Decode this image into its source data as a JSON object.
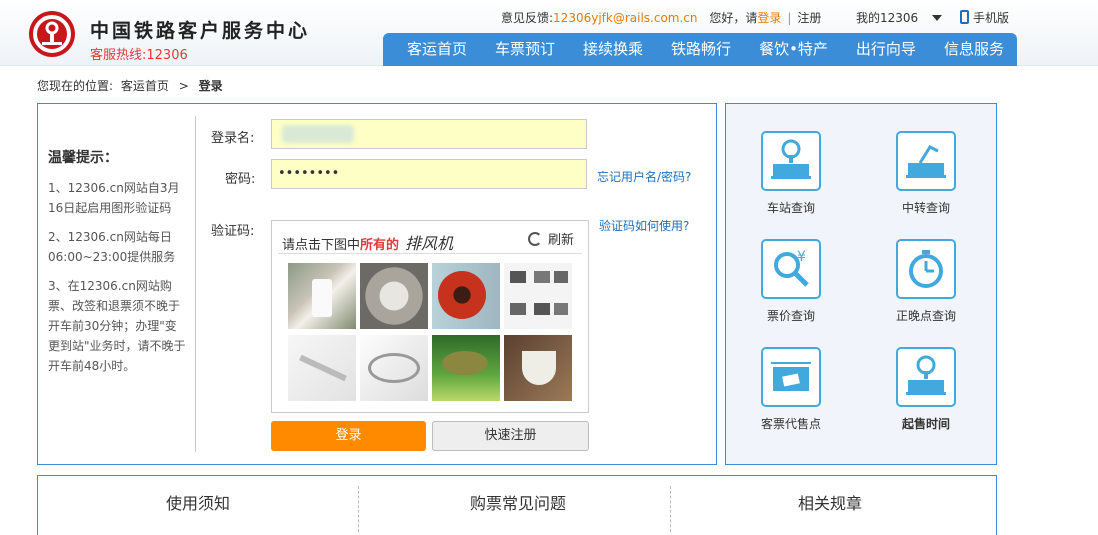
{
  "header": {
    "site_title": "中国铁路客户服务中心",
    "hotline": "客服热线:12306",
    "feedback_label": "意见反馈:",
    "feedback_email": "12306yjfk@rails.com.cn",
    "greeting": "您好，请",
    "login_link": "登录",
    "register_link": "注册",
    "my_account": "我的12306",
    "mobile": "手机版"
  },
  "nav": [
    "客运首页",
    "车票预订",
    "接续换乘",
    "铁路畅行",
    "餐饮•特产",
    "出行向导",
    "信息服务"
  ],
  "breadcrumb": {
    "prefix": "您现在的位置:",
    "home": "客运首页",
    "sep": ">",
    "current": "登录"
  },
  "tips": {
    "title": "温馨提示：",
    "items": [
      "1、12306.cn网站自3月16日起启用图形验证码",
      "2、12306.cn网站每日06:00~23:00提供服务",
      "3、在12306.cn网站购票、改签和退票须不晚于开车前30分钟；办理\"变更到站\"业务时，请不晚于开车前48小时。"
    ]
  },
  "form": {
    "username_label": "登录名:",
    "password_label": "密码:",
    "password_value": "••••••••",
    "captcha_label": "验证码:",
    "forgot_link": "忘记用户名/密码?",
    "captcha_help_link": "验证码如何使用?",
    "captcha_prompt_pre": "请点击下图中",
    "captcha_prompt_em": "所有的",
    "captcha_target": "排风机",
    "refresh": "刷新",
    "login_button": "登录",
    "register_button": "快速注册"
  },
  "services": [
    {
      "label": "车站查询",
      "icon": "station-icon"
    },
    {
      "label": "中转查询",
      "icon": "transfer-icon"
    },
    {
      "label": "票价查询",
      "icon": "fare-icon"
    },
    {
      "label": "正晚点查询",
      "icon": "clock-icon"
    },
    {
      "label": "客票代售点",
      "icon": "ticket-agent-icon"
    },
    {
      "label": "起售时间",
      "icon": "station-icon"
    }
  ],
  "bottom_tabs": [
    "使用须知",
    "购票常见问题",
    "相关规章"
  ],
  "colors": {
    "brand_blue": "#3a8dd6",
    "accent_orange": "#ff8a00",
    "logo_red": "#c8161d",
    "icon_blue": "#41a9dd"
  }
}
